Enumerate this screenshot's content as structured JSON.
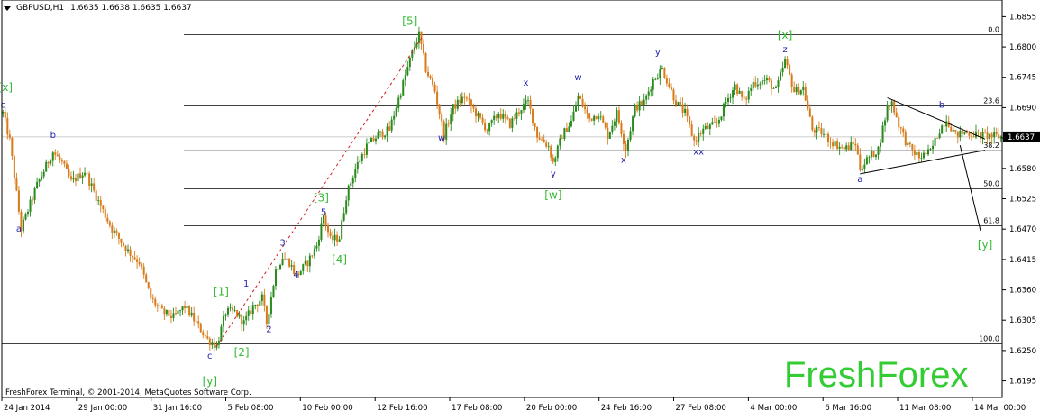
{
  "header": {
    "symbol": "GBPUSD,H1",
    "values": "1.6635 1.6638 1.6635 1.6637"
  },
  "footer": {
    "copyright": "FreshForex Terminal, © 2001-2014, MetaQuotes Software Corp."
  },
  "watermark": "FreshForex",
  "colors": {
    "bull": "#2a8a1e",
    "bear": "#d97b1a",
    "green_label": "#33bb33",
    "blue_label": "#2222aa",
    "wave_line": "#000000",
    "dashed_trend": "#cc2222",
    "grid": "#000000",
    "bid_line": "#bbbbbb"
  },
  "chart_data": {
    "type": "candlestick",
    "title": "",
    "ylim": [
      1.6165,
      1.6885
    ],
    "y_ticks": [
      "1.6855",
      "1.6800",
      "1.6745",
      "1.6690",
      "1.6635",
      "1.6580",
      "1.6525",
      "1.6470",
      "1.6415",
      "1.6360",
      "1.6305",
      "1.6250",
      "1.6195"
    ],
    "current_price": "1.6637",
    "x_ticks": [
      "24 Jan 2014",
      "29 Jan 00:00",
      "31 Jan 16:00",
      "5 Feb 08:00",
      "10 Feb 00:00",
      "12 Feb 16:00",
      "17 Feb 08:00",
      "20 Feb 00:00",
      "24 Feb 16:00",
      "27 Feb 08:00",
      "4 Mar 00:00",
      "6 Mar 16:00",
      "11 Mar 08:00",
      "14 Mar 00:00"
    ],
    "fib_levels": [
      {
        "label": "0.0",
        "price": 1.6822
      },
      {
        "label": "23.6",
        "price": 1.6693
      },
      {
        "label": "38.2",
        "price": 1.6612
      },
      {
        "label": "50.0",
        "price": 1.6543
      },
      {
        "label": "61.8",
        "price": 1.6476
      },
      {
        "label": "100.0",
        "price": 1.6262
      }
    ],
    "wave_labels": [
      {
        "text": "[x]",
        "style": "green",
        "bar": 1,
        "price": 1.672
      },
      {
        "text": "c",
        "style": "blue",
        "bar": 0,
        "price": 1.669
      },
      {
        "text": "b",
        "style": "blue",
        "bar": 22,
        "price": 1.6635
      },
      {
        "text": "a",
        "style": "blue",
        "bar": 7,
        "price": 1.6465
      },
      {
        "text": "[1]",
        "style": "green",
        "bar": 96,
        "price": 1.635
      },
      {
        "text": "1",
        "style": "blue",
        "bar": 107,
        "price": 1.6366
      },
      {
        "text": "2",
        "style": "blue",
        "bar": 117,
        "price": 1.6283
      },
      {
        "text": "3",
        "style": "blue",
        "bar": 123,
        "price": 1.644
      },
      {
        "text": "4",
        "style": "blue",
        "bar": 129,
        "price": 1.6382
      },
      {
        "text": "[2]",
        "style": "green",
        "bar": 105,
        "price": 1.624
      },
      {
        "text": "c",
        "style": "blue",
        "bar": 91,
        "price": 1.6235
      },
      {
        "text": "[y]",
        "style": "green",
        "bar": 91,
        "price": 1.6188
      },
      {
        "text": "[3]",
        "style": "green",
        "bar": 140,
        "price": 1.652
      },
      {
        "text": "5",
        "style": "blue",
        "bar": 141,
        "price": 1.6496
      },
      {
        "text": "[4]",
        "style": "green",
        "bar": 148,
        "price": 1.6408
      },
      {
        "text": "[5]",
        "style": "green",
        "bar": 179,
        "price": 1.684
      },
      {
        "text": "w",
        "style": "blue",
        "bar": 193,
        "price": 1.663
      },
      {
        "text": "x",
        "style": "blue",
        "bar": 230,
        "price": 1.673
      },
      {
        "text": "w",
        "style": "blue",
        "bar": 253,
        "price": 1.674
      },
      {
        "text": "y",
        "style": "blue",
        "bar": 242,
        "price": 1.6565
      },
      {
        "text": "[w]",
        "style": "green",
        "bar": 242,
        "price": 1.6525
      },
      {
        "text": "x",
        "style": "blue",
        "bar": 273,
        "price": 1.659
      },
      {
        "text": "y",
        "style": "blue",
        "bar": 288,
        "price": 1.6785
      },
      {
        "text": "xx",
        "style": "blue",
        "bar": 306,
        "price": 1.6605
      },
      {
        "text": "[x]",
        "style": "green",
        "bar": 344,
        "price": 1.6815
      },
      {
        "text": "z",
        "style": "blue",
        "bar": 344,
        "price": 1.679
      },
      {
        "text": "a",
        "style": "blue",
        "bar": 377,
        "price": 1.6555
      },
      {
        "text": "b",
        "style": "blue",
        "bar": 413,
        "price": 1.669
      },
      {
        "text": "[y]",
        "style": "green",
        "bar": 432,
        "price": 1.6435
      }
    ],
    "wave_lines": [
      {
        "style": "solid",
        "points": [
          [
            72,
            1.6347
          ],
          [
            120,
            1.6347
          ]
        ]
      },
      {
        "style": "dashed",
        "points": [
          [
            94,
            1.6258
          ],
          [
            185,
            1.6822
          ]
        ]
      },
      {
        "style": "solid",
        "points": [
          [
            389,
            1.6708
          ],
          [
            432,
            1.6633
          ]
        ]
      },
      {
        "style": "solid",
        "points": [
          [
            377,
            1.657
          ],
          [
            432,
            1.6613
          ]
        ]
      },
      {
        "style": "solid",
        "points": [
          [
            421,
            1.6622
          ],
          [
            430,
            1.6467
          ]
        ]
      }
    ]
  }
}
